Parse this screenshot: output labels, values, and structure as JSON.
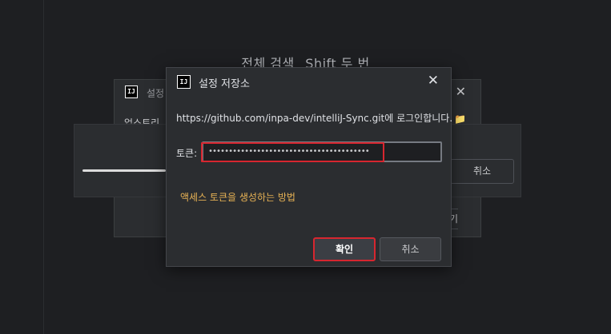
{
  "hint": {
    "text": "전체 검색",
    "key": "Shift 두 번"
  },
  "background_dialog": {
    "title": "설정",
    "logo": "IJ",
    "text": "업스트리",
    "close_icon": "✕",
    "folder_icon": "📁",
    "button_fragment": "기"
  },
  "progress": {
    "cancel_label": "취소",
    "fraction": 0.19
  },
  "dialog": {
    "logo": "IJ",
    "title": "설정 저장소",
    "close_icon": "✕",
    "message": "https://github.com/inpa-dev/intelliJ-Sync.git에 로그인합니다.",
    "token_label": "토큰:",
    "token_value": "••••••••••••••••••••••••••••••••••••••••",
    "help_link": "액세스 토큰을 생성하는 방법",
    "ok_label": "확인",
    "cancel_label": "취소"
  },
  "colors": {
    "background": "#1e1f22",
    "panel": "#2b2d30",
    "highlight": "#d7262f",
    "link": "#e6b154"
  }
}
